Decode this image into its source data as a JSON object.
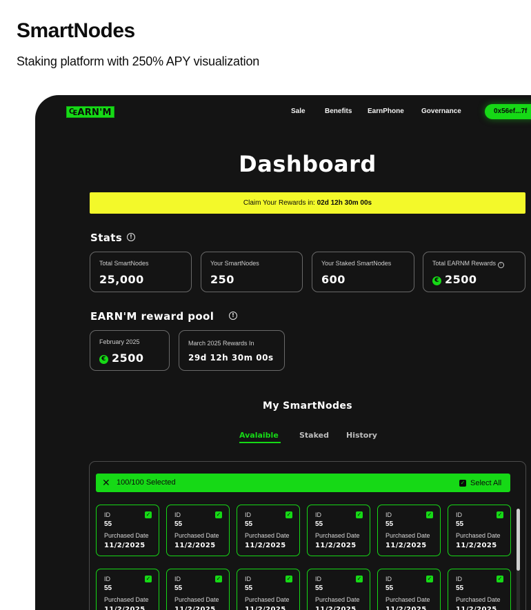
{
  "header": {
    "title": "SmartNodes",
    "subtitle": "Staking platform with 250% APY visualization"
  },
  "nav": {
    "logo": "₠ARN'M",
    "items": [
      "Sale",
      "Benefits",
      "EarnPhone",
      "Governance"
    ],
    "wallet": "0x56ef...7f"
  },
  "dashboard": {
    "title": "Dashboard",
    "claim_label": "Claim Your Rewards in:",
    "claim_time": "02d 12h 30m 00s"
  },
  "stats": {
    "title": "Stats",
    "cards": [
      {
        "label": "Total SmartNodes",
        "value": "25,000"
      },
      {
        "label": "Your SmartNodes",
        "value": "250"
      },
      {
        "label": "Your Staked SmartNodes",
        "value": "600"
      },
      {
        "label": "Total EARNM Rewards",
        "value": "2500"
      }
    ]
  },
  "reward_pool": {
    "title": "EARN'M reward pool",
    "month_label": "February 2025",
    "month_value": "2500",
    "next_label": "March 2025 Rewards In",
    "next_value": "29d 12h 30m 00s"
  },
  "my_smartnodes": {
    "title": "My SmartNodes",
    "tabs": [
      "Avalaible",
      "Staked",
      "History"
    ],
    "active_tab": "Avalaible",
    "selected": "100/100 Selected",
    "select_all": "Select All",
    "id_label": "ID",
    "date_label": "Purchased Date",
    "nodes": [
      {
        "id": "55",
        "date": "11/2/2025"
      },
      {
        "id": "55",
        "date": "11/2/2025"
      },
      {
        "id": "55",
        "date": "11/2/2025"
      },
      {
        "id": "55",
        "date": "11/2/2025"
      },
      {
        "id": "55",
        "date": "11/2/2025"
      },
      {
        "id": "55",
        "date": "11/2/2025"
      },
      {
        "id": "55",
        "date": "11/2/2025"
      },
      {
        "id": "55",
        "date": "11/2/2025"
      },
      {
        "id": "55",
        "date": "11/2/2025"
      },
      {
        "id": "55",
        "date": "11/2/2025"
      },
      {
        "id": "55",
        "date": "11/2/2025"
      },
      {
        "id": "55",
        "date": "11/2/2025"
      }
    ]
  },
  "colors": {
    "accent": "#16d916",
    "banner": "#f3f92a",
    "background": "#141414"
  }
}
